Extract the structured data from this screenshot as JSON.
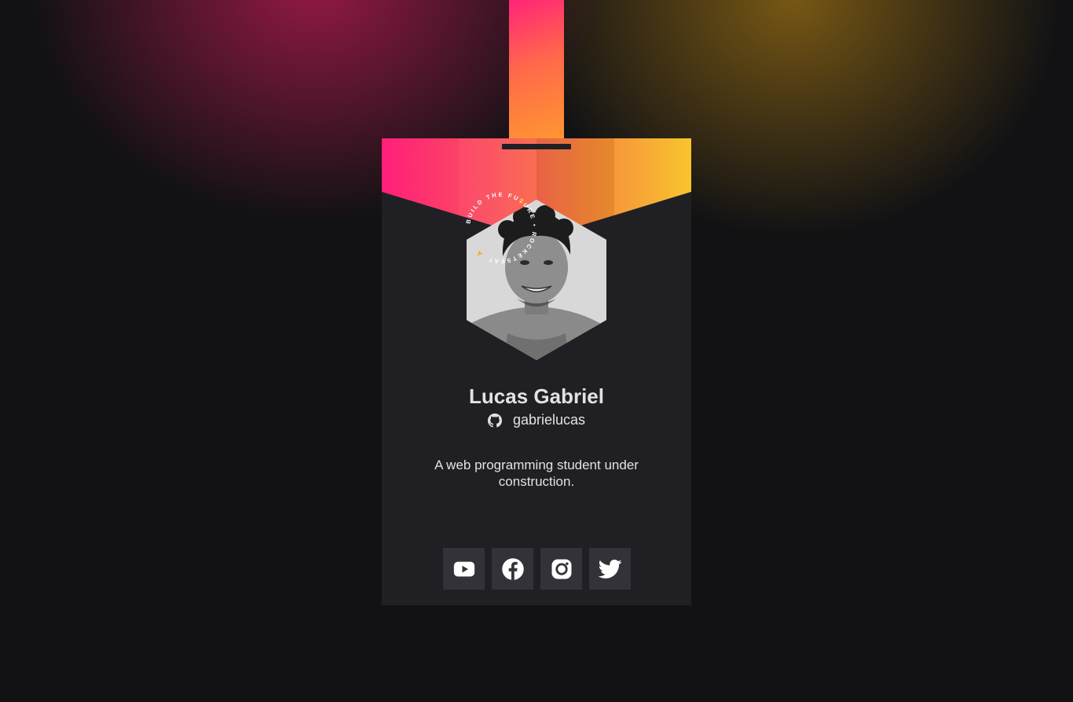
{
  "colors": {
    "background": "#121214",
    "card": "#202024",
    "button": "#323238",
    "text": "#e1e1e6",
    "accent_pink": "#ff2477",
    "accent_orange": "#ff9a2e",
    "accent_yellow": "#f9c123"
  },
  "profile": {
    "name": "Lucas Gabriel",
    "github_user": "gabrielucas",
    "bio": "A web programming student under construction.",
    "avatar_badge_text": "BUILD THE FUTURE • ROCKETSEAT"
  },
  "socials": [
    {
      "icon": "youtube-icon"
    },
    {
      "icon": "facebook-icon"
    },
    {
      "icon": "instagram-icon"
    },
    {
      "icon": "twitter-icon"
    }
  ]
}
